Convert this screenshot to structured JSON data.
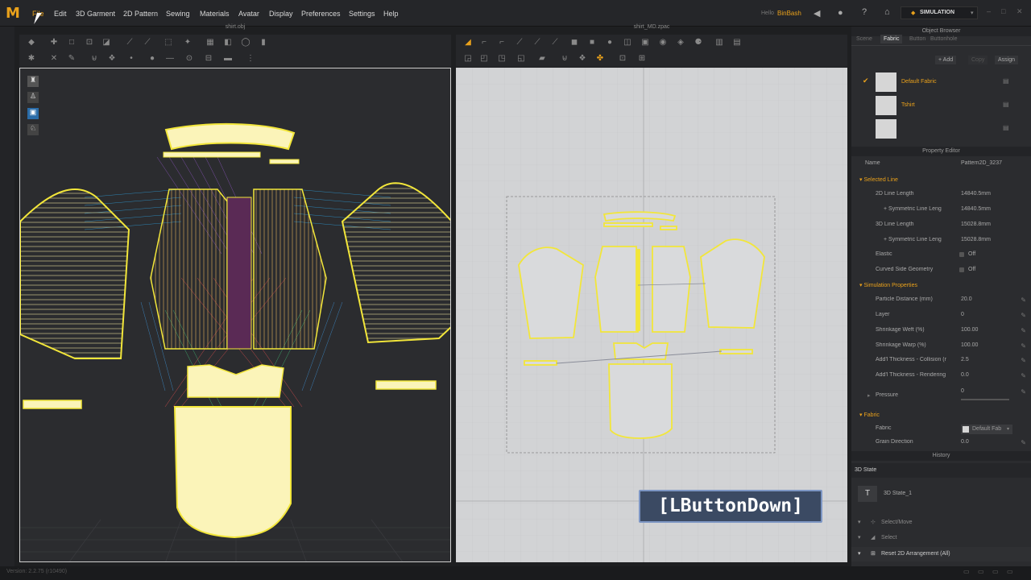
{
  "menubar": {
    "logo": "M",
    "items": [
      "File",
      "3D Garment",
      "2D Pattern",
      "Sewing",
      "Materials",
      "Avatar",
      "Display",
      "Preferences",
      "Settings",
      "Help"
    ],
    "edit_label": "Edit",
    "user_label": "Hello",
    "user_name": "BinBash",
    "mode_label": "SIMULATION"
  },
  "panels": {
    "left_title": "shirt.obj",
    "right_title": "shirt_MD.zpac"
  },
  "object_browser": {
    "title": "Object Browser",
    "tabs": [
      "Scene",
      "Fabric",
      "Button",
      "Buttonhole"
    ],
    "add_label": "+ Add",
    "copy_label": "Copy",
    "assign_label": "Assign",
    "fabrics": [
      "Default Fabric",
      "Tshirt",
      ""
    ]
  },
  "property_editor": {
    "title": "Property Editor",
    "name_label": "Name",
    "name_value": "Pattern2D_3237",
    "selected_line": "Selected Line",
    "selected_rows": [
      {
        "label": "2D Line Length",
        "value": "14840.5mm"
      },
      {
        "label": "+ Symmetric Line Leng",
        "value": "14840.5mm"
      },
      {
        "label": "3D Line Length",
        "value": "15028.8mm"
      },
      {
        "label": "+ Symmetric Line Leng",
        "value": "15028.8mm"
      },
      {
        "label": "Elastic",
        "value": "Off"
      },
      {
        "label": "Curved Side Geometry",
        "value": "Off"
      }
    ],
    "simulation_properties": "Simulation Properties",
    "sim_rows": [
      {
        "label": "Particle Distance (mm)",
        "value": "20.0"
      },
      {
        "label": "Layer",
        "value": "0"
      },
      {
        "label": "Shrinkage Weft (%)",
        "value": "100.00"
      },
      {
        "label": "Shrinkage Warp (%)",
        "value": "100.00"
      },
      {
        "label": "Add'l Thickness - Collision (r",
        "value": "2.5"
      },
      {
        "label": "Add'l Thickness - Rendering",
        "value": "0.0"
      }
    ],
    "pressure_label": "Pressure",
    "pressure_value": "0",
    "fabric_section": "Fabric",
    "fabric_label": "Fabric",
    "fabric_value": "Default Fab",
    "grain_label": "Grain Direction",
    "grain_value": "0.0"
  },
  "history": {
    "title": "History",
    "state_label": "3D State",
    "state_item": "3D State_1",
    "items": [
      "Select/Move",
      "Select",
      "Reset 2D Arrangement (All)"
    ]
  },
  "overlay": {
    "event_label": "[LButtonDown]"
  },
  "statusbar": {
    "version": "Version: 2.2.75    (r10490)"
  },
  "colors": {
    "accent": "#e9a11b",
    "pattern_fill": "#fbf4b9",
    "pattern_outline": "#f2e63a"
  }
}
